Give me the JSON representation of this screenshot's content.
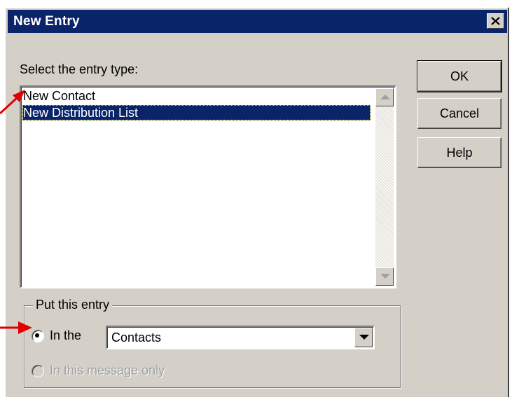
{
  "window": {
    "title": "New Entry",
    "title_bar_color": "#0a246a"
  },
  "entry_type": {
    "label": "Select the entry type:",
    "items": [
      {
        "label": "New Contact",
        "selected": false
      },
      {
        "label": "New Distribution List",
        "selected": true
      }
    ]
  },
  "buttons": {
    "ok": "OK",
    "cancel": "Cancel",
    "help": "Help"
  },
  "placement": {
    "group_label": "Put this entry",
    "option_in_the": {
      "label": "In the",
      "checked": true
    },
    "folder_value": "Contacts",
    "option_message_only": {
      "label": "In this message only",
      "checked": false,
      "disabled": true
    }
  },
  "icons": {
    "close": "close-icon",
    "scroll_up": "arrow-up-icon",
    "scroll_down": "arrow-down-icon",
    "dropdown": "chevron-down-icon",
    "annotation_arrow": "red-arrow-icon"
  },
  "colors": {
    "annotation": "#e00000",
    "selection": "#0a246a",
    "face": "#d4d0c8"
  }
}
